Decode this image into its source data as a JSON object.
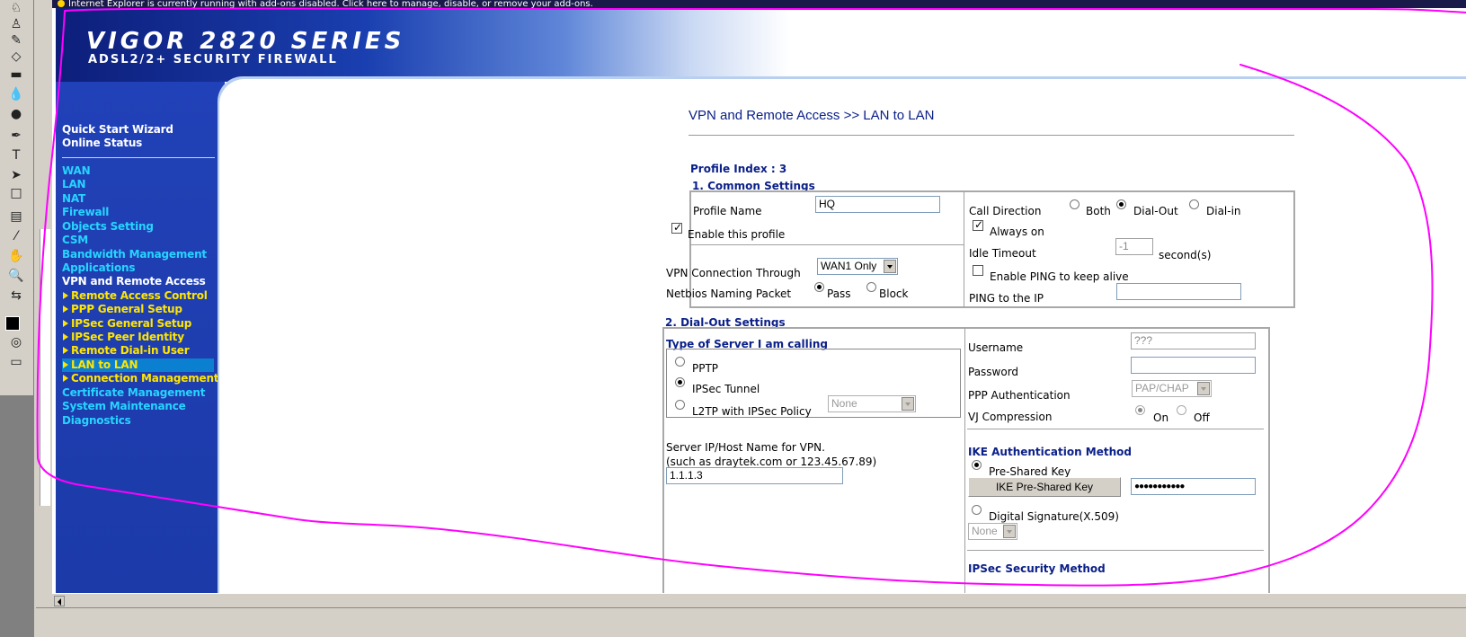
{
  "infobar": {
    "message": "Internet Explorer is currently running with add-ons disabled. Click here to manage, disable, or remove your add-ons."
  },
  "banner": {
    "title": "VIGOR 2820 SERIES",
    "subtitle": "ADSL2/2+ SECURITY FIREWALL"
  },
  "sidebar": {
    "items": [
      {
        "label": "Quick Start Wizard",
        "style": "white"
      },
      {
        "label": "Online Status",
        "style": "white"
      },
      {
        "label": "WAN",
        "style": "cyan"
      },
      {
        "label": "LAN",
        "style": "cyan"
      },
      {
        "label": "NAT",
        "style": "cyan"
      },
      {
        "label": "Firewall",
        "style": "cyan"
      },
      {
        "label": "Objects Setting",
        "style": "cyan"
      },
      {
        "label": "CSM",
        "style": "cyan"
      },
      {
        "label": "Bandwidth Management",
        "style": "cyan"
      },
      {
        "label": "Applications",
        "style": "cyan"
      },
      {
        "label": "VPN and Remote Access",
        "style": "white"
      },
      {
        "label": "Remote Access Control",
        "style": "sub"
      },
      {
        "label": "PPP General Setup",
        "style": "sub"
      },
      {
        "label": "IPSec General Setup",
        "style": "sub"
      },
      {
        "label": "IPSec Peer Identity",
        "style": "sub"
      },
      {
        "label": "Remote Dial-in User",
        "style": "sub"
      },
      {
        "label": "LAN to LAN",
        "style": "sub-selected"
      },
      {
        "label": "Connection Management",
        "style": "sub"
      },
      {
        "label": "Certificate Management",
        "style": "cyan"
      },
      {
        "label": "System Maintenance",
        "style": "cyan"
      },
      {
        "label": "Diagnostics",
        "style": "cyan"
      }
    ]
  },
  "page": {
    "title": "VPN and Remote Access >> LAN to LAN",
    "profile_index": "Profile Index : 3"
  },
  "common": {
    "heading": "1. Common Settings",
    "profile_name_label": "Profile Name",
    "profile_name_value": "HQ",
    "enable_profile_label": "Enable this profile",
    "vpn_through_label": "VPN Connection Through",
    "vpn_through_value": "WAN1 Only",
    "netbios_label": "Netbios Naming Packet",
    "netbios_pass": "Pass",
    "netbios_block": "Block",
    "call_direction_label": "Call Direction",
    "dir_both": "Both",
    "dir_dialout": "Dial-Out",
    "dir_dialin": "Dial-in",
    "always_on_label": "Always on",
    "idle_timeout_label": "Idle Timeout",
    "idle_timeout_value": "-1",
    "idle_timeout_unit": "second(s)",
    "enable_ping_label": "Enable PING to keep alive",
    "ping_ip_label": "PING to the IP",
    "ping_ip_value": ""
  },
  "dialout": {
    "heading": "2. Dial-Out Settings",
    "server_type_heading": "Type of Server I am calling",
    "pptp": "PPTP",
    "ipsec_tunnel": "IPSec Tunnel",
    "l2tp": "L2TP with IPSec Policy",
    "l2tp_policy_value": "None",
    "server_ip_label": "Server IP/Host Name for VPN.",
    "server_ip_hint": "(such as draytek.com or 123.45.67.89)",
    "server_ip_value": "1.1.1.3",
    "username_label": "Username",
    "username_value": "???",
    "password_label": "Password",
    "password_value": "",
    "ppp_auth_label": "PPP Authentication",
    "ppp_auth_value": "PAP/CHAP",
    "vj_label": "VJ Compression",
    "vj_on": "On",
    "vj_off": "Off",
    "ike_heading": "IKE Authentication Method",
    "pre_shared_label": "Pre-Shared Key",
    "ike_button": "IKE Pre-Shared Key",
    "ike_key_value": "●●●●●●●●●●●",
    "digital_sig_label": "Digital Signature(X.509)",
    "digital_sig_value": "None",
    "ipsec_method_partial": "IPSec Security Method"
  },
  "colors": {
    "annotation": "#ff00ff",
    "banner_dark": "#0d1e7a",
    "sidebar": "#2141b8",
    "heading_blue": "#0b2088"
  }
}
